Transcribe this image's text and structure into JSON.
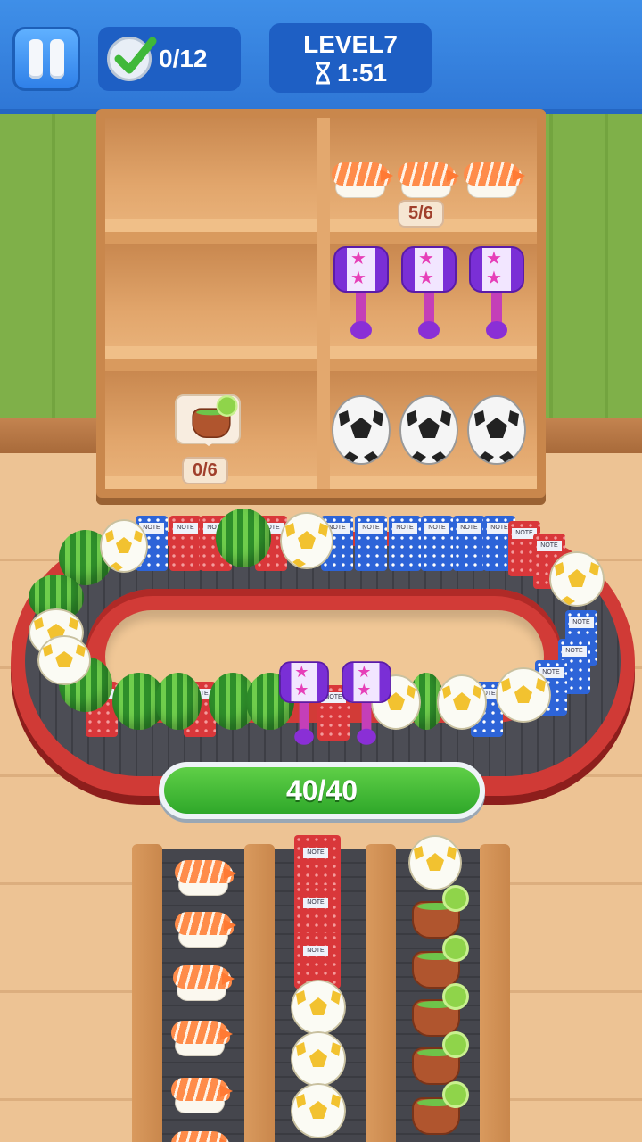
{
  "hud": {
    "pause_icon": "pause-icon",
    "goal_icon": "checkmark-icon",
    "goal_progress": "0/12",
    "level": "LEVEL7",
    "timer_icon": "hourglass-icon",
    "timer": "1:51"
  },
  "shelf": {
    "sushi_count": "5/6",
    "cocktail_count": "0/6",
    "cocktail_hint_icon": "cocktail-pot-icon"
  },
  "conveyor": {
    "capacity": "40/40"
  },
  "colors": {
    "topbar": "#2f77d6",
    "progress_green": "#2fa82a",
    "track_red": "#d03a36"
  }
}
